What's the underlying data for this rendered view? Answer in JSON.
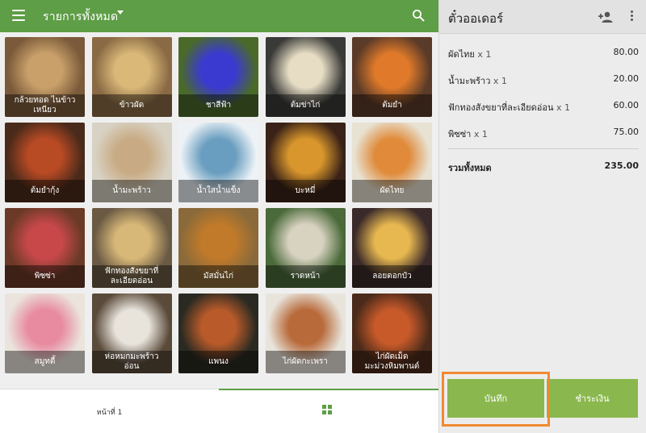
{
  "header": {
    "category": "รายการทั้งหมด"
  },
  "menu": [
    {
      "label": "กล้วยทอด ไนข้าว\nเหนียว",
      "icon": "fried-banana",
      "bg": "#7a5a3a",
      "accent": "#c9a06a"
    },
    {
      "label": "ข้าวผัด",
      "icon": "fried-rice",
      "bg": "#8a6a44",
      "accent": "#d9b878"
    },
    {
      "label": "ชาสีฟ้า",
      "icon": "blue-tea",
      "bg": "#4a6a2a",
      "accent": "#3a3ad0"
    },
    {
      "label": "ต้มข่าไก่",
      "icon": "tom-kha",
      "bg": "#3a3a38",
      "accent": "#e6ddc4"
    },
    {
      "label": "ต้มยำ",
      "icon": "tom-yum",
      "bg": "#5a3a28",
      "accent": "#e07a2a"
    },
    {
      "label": "ต้มยำกุ้ง",
      "icon": "tom-yum-goong",
      "bg": "#4a2a1a",
      "accent": "#b84a24"
    },
    {
      "label": "น้ำมะพร้าว",
      "icon": "coconut-water",
      "bg": "#d8d2c4",
      "accent": "#c8ab84"
    },
    {
      "label": "น้ำใสน้ำแข็ง",
      "icon": "ice-water",
      "bg": "#ecf2f6",
      "accent": "#6a9ec0"
    },
    {
      "label": "บะหมี่",
      "icon": "noodles",
      "bg": "#3a2218",
      "accent": "#d8962c"
    },
    {
      "label": "ผัดไทย",
      "icon": "pad-thai",
      "bg": "#e8e2d2",
      "accent": "#e08a3a"
    },
    {
      "label": "พิซซ่า",
      "icon": "pizza",
      "bg": "#6a3a26",
      "accent": "#c8484a"
    },
    {
      "label": "ฟักทองสังขยาที่\nละเอียดอ่อน",
      "icon": "pumpkin-custard",
      "bg": "#6a5a44",
      "accent": "#d8b878"
    },
    {
      "label": "มัสมั่นไก่",
      "icon": "massaman",
      "bg": "#8a6a3a",
      "accent": "#c07a2a"
    },
    {
      "label": "ราดหน้า",
      "icon": "rad-na",
      "bg": "#4a6a3a",
      "accent": "#d8d2c0"
    },
    {
      "label": "ลอยดอกบัว",
      "icon": "lotus-dessert",
      "bg": "#3a2a2a",
      "accent": "#e8b850"
    },
    {
      "label": "สมูทตี้",
      "icon": "smoothie",
      "bg": "#eae4dc",
      "accent": "#e88aa0"
    },
    {
      "label": "ห่อหมกมะพร้าว\nอ่อน",
      "icon": "hor-mok",
      "bg": "#5a4a3a",
      "accent": "#e8e4dc"
    },
    {
      "label": "แพนง",
      "icon": "panang",
      "bg": "#2a2a22",
      "accent": "#b85a2a"
    },
    {
      "label": "ไก่ผัดกะเพรา",
      "icon": "kra-pao",
      "bg": "#e8e4dc",
      "accent": "#b86a3a"
    },
    {
      "label": "ไก่ผัดเม็ด\nมะม่วงหิมพานต์",
      "icon": "cashew-chicken",
      "bg": "#4a2a1a",
      "accent": "#c85a2a"
    }
  ],
  "footer": {
    "page_label": "หน้าที่ 1"
  },
  "ticket": {
    "title": "ตั๋วออเดอร์",
    "lines": [
      {
        "name": "ผัดไทย",
        "qty": "x 1",
        "price": "80.00"
      },
      {
        "name": "น้ำมะพร้าว",
        "qty": "x 1",
        "price": "20.00"
      },
      {
        "name": "ฟักทองสังขยาที่ละเอียดอ่อน",
        "qty": "x 1",
        "price": "60.00"
      },
      {
        "name": "พิซซ่า",
        "qty": "x 1",
        "price": "75.00"
      }
    ],
    "total_label": "รวมทั้งหมด",
    "total_value": "235.00",
    "save_label": "บันทึก",
    "pay_label": "ชำระเงิน"
  },
  "colors": {
    "brand": "#5e9e46",
    "button": "#8bb84e",
    "highlight": "#f08a31"
  }
}
